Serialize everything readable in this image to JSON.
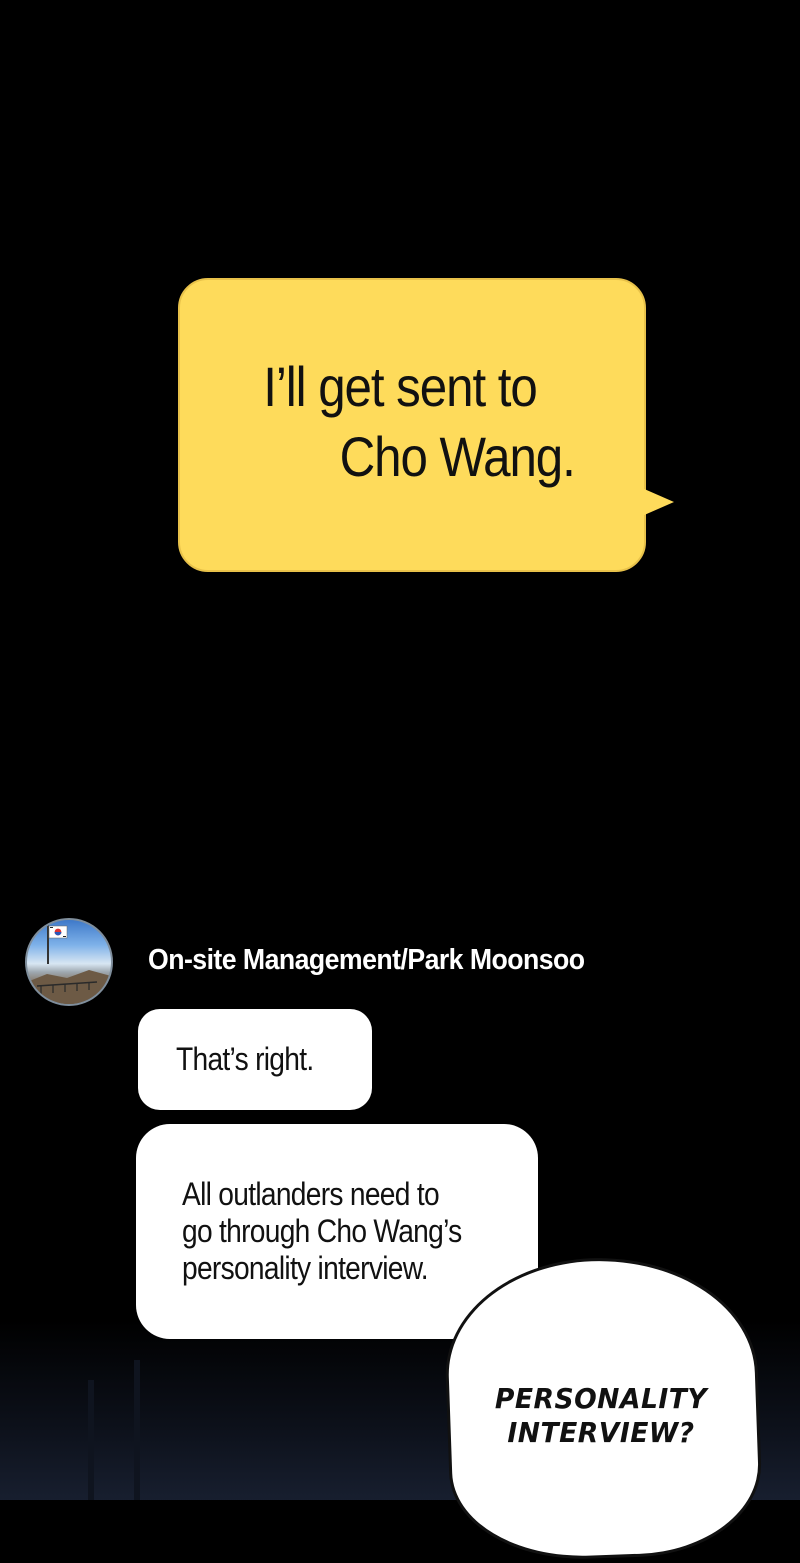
{
  "outgoing_message": {
    "line1": "I’ll get sent to",
    "line2": "Cho Wang."
  },
  "contact": {
    "name": "On-site Management/Park Moonsoo",
    "avatar": "flag-on-mountain-avatar"
  },
  "incoming_messages": [
    {
      "lines": [
        "That’s right."
      ]
    },
    {
      "lines": [
        "All outlanders need to",
        "go through Cho Wang’s",
        "personality interview."
      ]
    }
  ],
  "speech_balloon": {
    "lines": [
      "PERSONALITY",
      "INTERVIEW?"
    ]
  },
  "colors": {
    "background": "#000000",
    "outgoing_bubble": "#fedb5b",
    "incoming_bubble": "#ffffff",
    "contact_name": "#ffffff"
  }
}
